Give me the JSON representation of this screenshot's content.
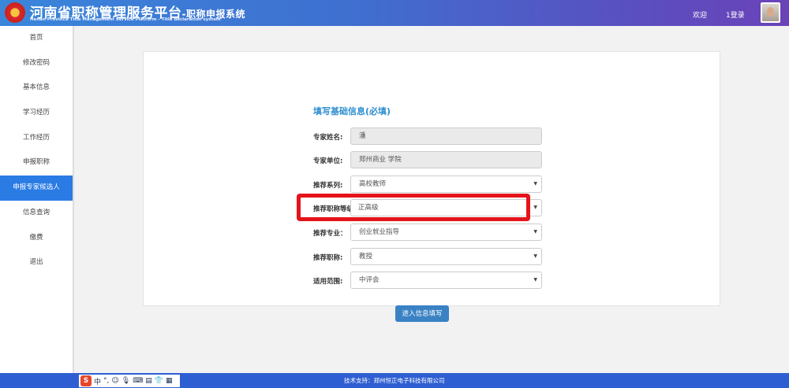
{
  "header": {
    "title": "河南省职称管理服务平台",
    "title_suffix": "-职称申报系统",
    "subtitle": "Henan Province Title Management Service Platform - Title declaration system",
    "welcome": "欢迎",
    "login": "1登录"
  },
  "sidebar": {
    "items": [
      {
        "label": "首页"
      },
      {
        "label": "修改密码"
      },
      {
        "label": "基本信息"
      },
      {
        "label": "学习经历"
      },
      {
        "label": "工作经历"
      },
      {
        "label": "申报职称"
      },
      {
        "label": "申报专家候选人",
        "active": true
      },
      {
        "label": "信息查询"
      },
      {
        "label": "缴费"
      },
      {
        "label": "退出"
      }
    ]
  },
  "form": {
    "title": "填写基础信息(必填)",
    "fields": [
      {
        "label": "专家姓名:",
        "value": "潘"
      },
      {
        "label": "专家单位:",
        "value": "郑州商业 学院"
      },
      {
        "label": "推荐系列:",
        "value": "高校教师"
      },
      {
        "label": "推荐职称等级",
        "value": "正高级"
      },
      {
        "label": "推荐专业：",
        "value": "创业就业指导"
      },
      {
        "label": "推荐职称:",
        "value": "教授"
      },
      {
        "label": "适用范围:",
        "value": "中评会"
      }
    ],
    "submit": "进入信息填写"
  },
  "footer": {
    "text": "技术支持：郑州恒正电子科技有限公司"
  },
  "ime": {
    "logo": "S",
    "mode": "中"
  },
  "colors": {
    "accent": "#2a7be4",
    "highlight": "#e5141b",
    "footer": "#2e5fd2"
  }
}
